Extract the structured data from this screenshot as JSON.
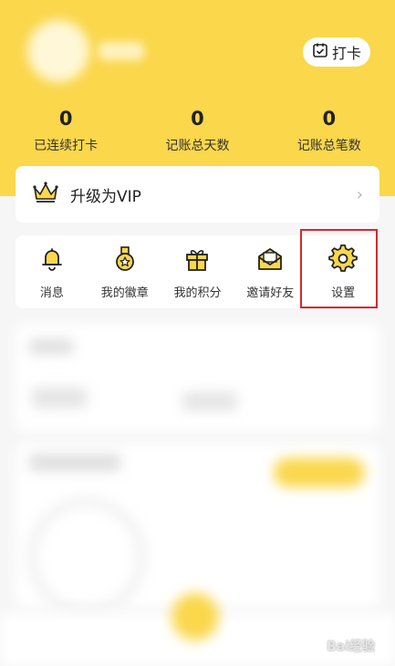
{
  "header": {
    "checkin_label": "打卡"
  },
  "stats": [
    {
      "value": "0",
      "label": "已连续打卡"
    },
    {
      "value": "0",
      "label": "记账总天数"
    },
    {
      "value": "0",
      "label": "记账总笔数"
    }
  ],
  "vip": {
    "label": "升级为VIP"
  },
  "shortcuts": [
    {
      "label": "消息",
      "icon": "bell-icon"
    },
    {
      "label": "我的徽章",
      "icon": "medal-icon"
    },
    {
      "label": "我的积分",
      "icon": "gift-icon"
    },
    {
      "label": "邀请好友",
      "icon": "envelope-icon"
    },
    {
      "label": "设置",
      "icon": "gear-icon"
    }
  ],
  "colors": {
    "brand_yellow": "#fad74b",
    "highlight_red": "#d22b2b"
  },
  "watermark": "Bai经验"
}
